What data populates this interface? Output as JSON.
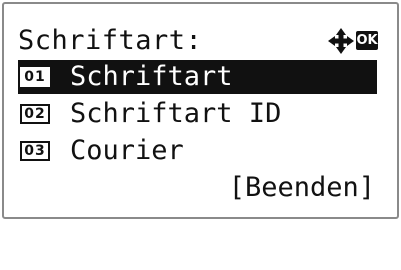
{
  "screen": {
    "title": "Schriftart:",
    "nav_icon": "four-way-arrows-icon",
    "ok_label": "OK"
  },
  "menu": [
    {
      "number": "01",
      "label": "Schriftart",
      "selected": true
    },
    {
      "number": "02",
      "label": "Schriftart ID",
      "selected": false
    },
    {
      "number": "03",
      "label": "Courier",
      "selected": false
    }
  ],
  "footer": {
    "exit_label": "[Beenden]"
  },
  "colors": {
    "foreground": "#111111",
    "background": "#ffffff",
    "highlight": "#111111",
    "frame": "#8a8a8a"
  }
}
